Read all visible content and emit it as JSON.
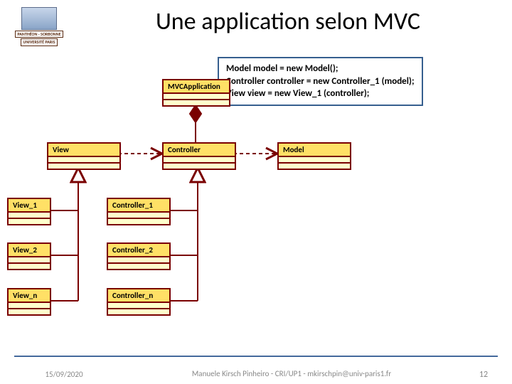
{
  "logo": {
    "line1": "PANTHÉON - SORBONNE",
    "line2": "UNIVERSITÉ PARIS"
  },
  "title": "Une application selon MVC",
  "code": {
    "l1": "Model model = new Model();",
    "l2": "Controller controller = new Controller_1 (model);",
    "l3": "View view = new View_1 (controller);"
  },
  "classes": {
    "mvcapp": "MVCApplication",
    "view": "View",
    "controller": "Controller",
    "model": "Model",
    "view1": "View_1",
    "view2": "View_2",
    "viewn": "View_n",
    "ctrl1": "Controller_1",
    "ctrl2": "Controller_2",
    "ctrln": "Controller_n"
  },
  "footer": {
    "date": "15/09/2020",
    "author": "Manuele Kirsch Pinheiro - CRI/UP1 - mkirschpin@univ-paris1.fr",
    "page": "12"
  }
}
